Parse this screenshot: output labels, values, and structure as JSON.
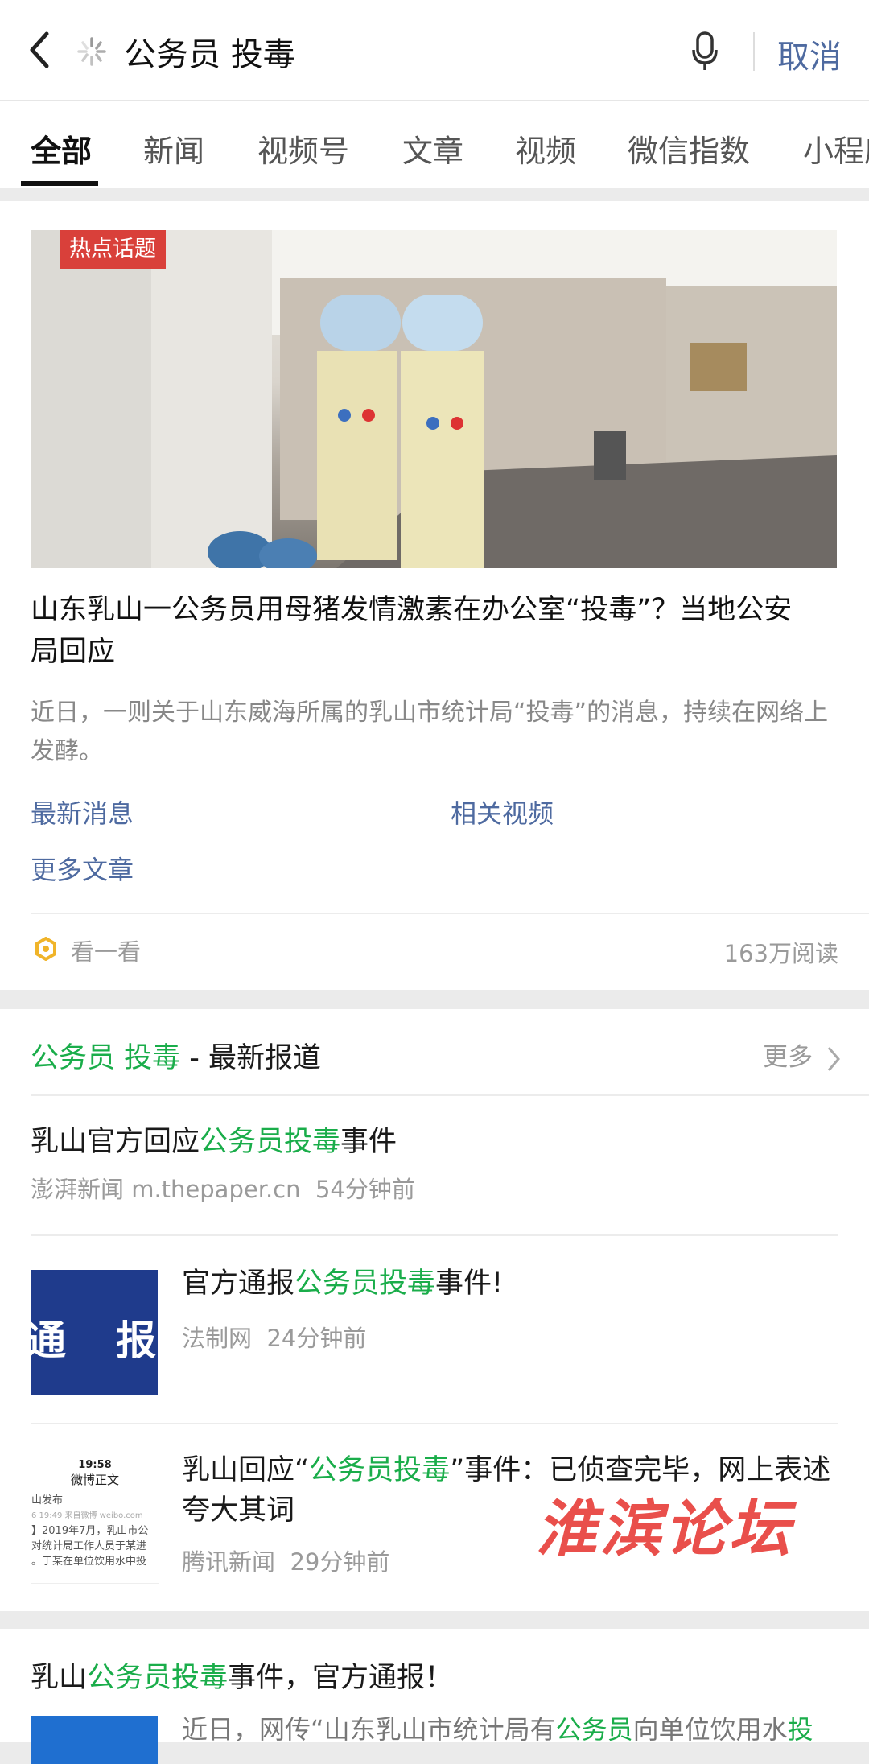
{
  "search": {
    "query": "公务员 投毒",
    "cancel_label": "取消"
  },
  "tabs": [
    "全部",
    "新闻",
    "视频号",
    "文章",
    "视频",
    "微信指数",
    "小程序"
  ],
  "hot_topic": {
    "badge": "热点话题",
    "title": "山东乳山一公务员用母猪发情激素在办公室“投毒”？当地公安局回应",
    "summary": "近日，一则关于山东威海所属的乳山市统计局“投毒”的消息，持续在网络上发酵。",
    "links": [
      "最新消息",
      "相关视频",
      "更多文章"
    ],
    "footer_label": "看一看",
    "reads": "163万阅读"
  },
  "news_section": {
    "keyword": "公务员 投毒",
    "heading_suffix": " - 最新报道",
    "more_label": "更多",
    "items": [
      {
        "title_pre": "乳山官方回应",
        "title_hl": "公务员投毒",
        "title_post": "事件",
        "source": "澎湃新闻 m.thepaper.cn",
        "time": "54分钟前"
      },
      {
        "title_pre": "官方通报",
        "title_hl": "公务员投毒",
        "title_post": "事件!",
        "source": "法制网",
        "time": "24分钟前",
        "thumb_text": "通　报"
      },
      {
        "title_pre": "乳山回应“",
        "title_hl": "公务员投毒",
        "title_post": "”事件：已侦查完毕，网上表述夸大其词",
        "source": "腾讯新闻",
        "time": "29分钟前",
        "thumb": {
          "time": "19:58",
          "header": "微博正文",
          "lines": [
            "山发布",
            "6 19:49 来自微博 weibo.com",
            "】2019年7月，乳山市公",
            "对统计局工作人员于某进",
            "。于某在单位饮用水中投"
          ]
        }
      }
    ]
  },
  "article": {
    "title_pre": "乳山",
    "title_hl": "公务员投毒",
    "title_post": "事件，官方通报！",
    "snippet_pre": "近日，网传“山东乳山市统计局有",
    "snippet_hl": "公务员",
    "snippet_mid": "向单位饮用水",
    "snippet_hl2": "投"
  },
  "watermark": "淮滨论坛",
  "colors": {
    "accent": "#1aad4a",
    "link": "#4e6aa0",
    "badge": "#d9403a",
    "watermark": "#e8413c"
  }
}
